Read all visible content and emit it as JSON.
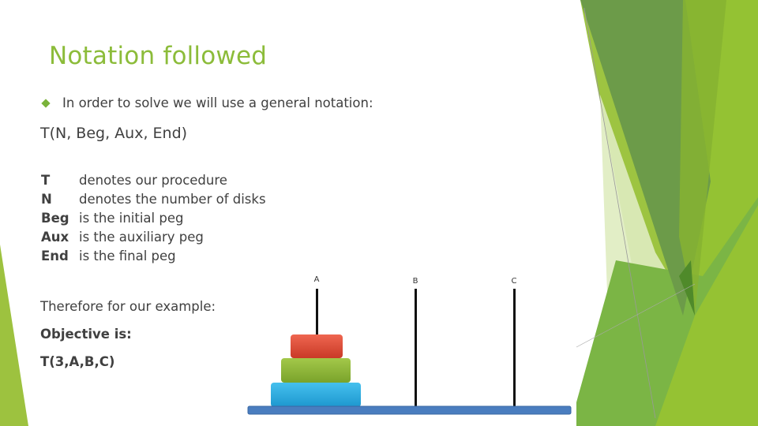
{
  "slide": {
    "title": "Notation followed",
    "bullet": "In order to solve we will use a general notation:",
    "signature": "T(N, Beg, Aux, End)",
    "definitions": [
      {
        "term": "T",
        "desc": "denotes our procedure"
      },
      {
        "term": "N",
        "desc": "denotes the number of disks"
      },
      {
        "term": "Beg",
        "desc": "is the initial peg"
      },
      {
        "term": "Aux",
        "desc": "is the auxiliary peg"
      },
      {
        "term": "End",
        "desc": "is the final peg"
      }
    ],
    "example_intro": "Therefore for our example:",
    "objective_label": "Objective is:",
    "objective_value": "T(3,A,B,C)"
  },
  "diagram": {
    "pegs": [
      "A",
      "B",
      "C"
    ],
    "disks": [
      {
        "name": "small",
        "color": "#e04a33",
        "on_peg": "A"
      },
      {
        "name": "medium",
        "color": "#8ab634",
        "on_peg": "A"
      },
      {
        "name": "large",
        "color": "#26ade4",
        "on_peg": "A"
      }
    ],
    "base_color": "#4a7dbf"
  },
  "theme": {
    "accent": "#8cbc3a",
    "text": "#404040"
  }
}
